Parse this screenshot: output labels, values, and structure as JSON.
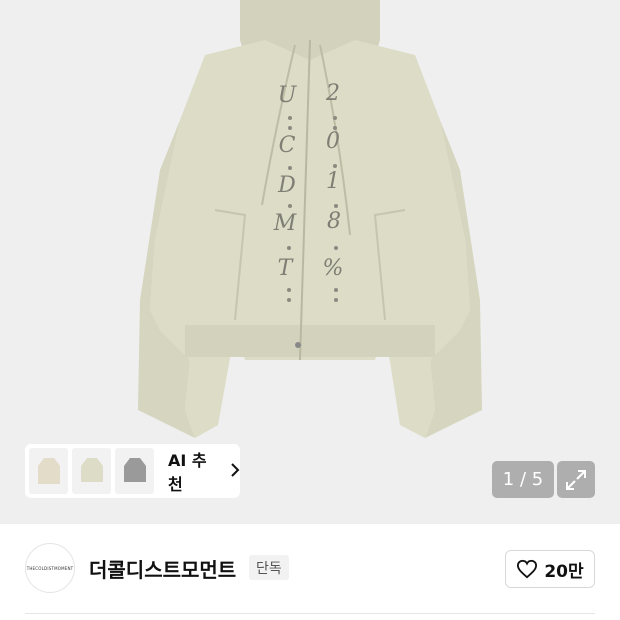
{
  "gallery": {
    "counter": "1 / 5",
    "ai_chip": {
      "label": "AI 추천",
      "chevron": "chevron-right-icon"
    },
    "expand_icon": "expand-arrows-icon",
    "product_text_left": [
      "U",
      "C",
      "D",
      "M",
      "T"
    ],
    "product_text_right": [
      "2",
      "0",
      "1",
      "8",
      "%"
    ]
  },
  "brand": {
    "logo_text": "THECOLDISTMOMENT",
    "name": "더콜디스트모먼트",
    "badge": "단독"
  },
  "like": {
    "count": "20만",
    "icon": "heart-icon"
  },
  "colors": {
    "hoodie": "#dcdcc7",
    "hoodie_shadow": "#c8c8b0",
    "gallery_bg": "#efefef"
  }
}
